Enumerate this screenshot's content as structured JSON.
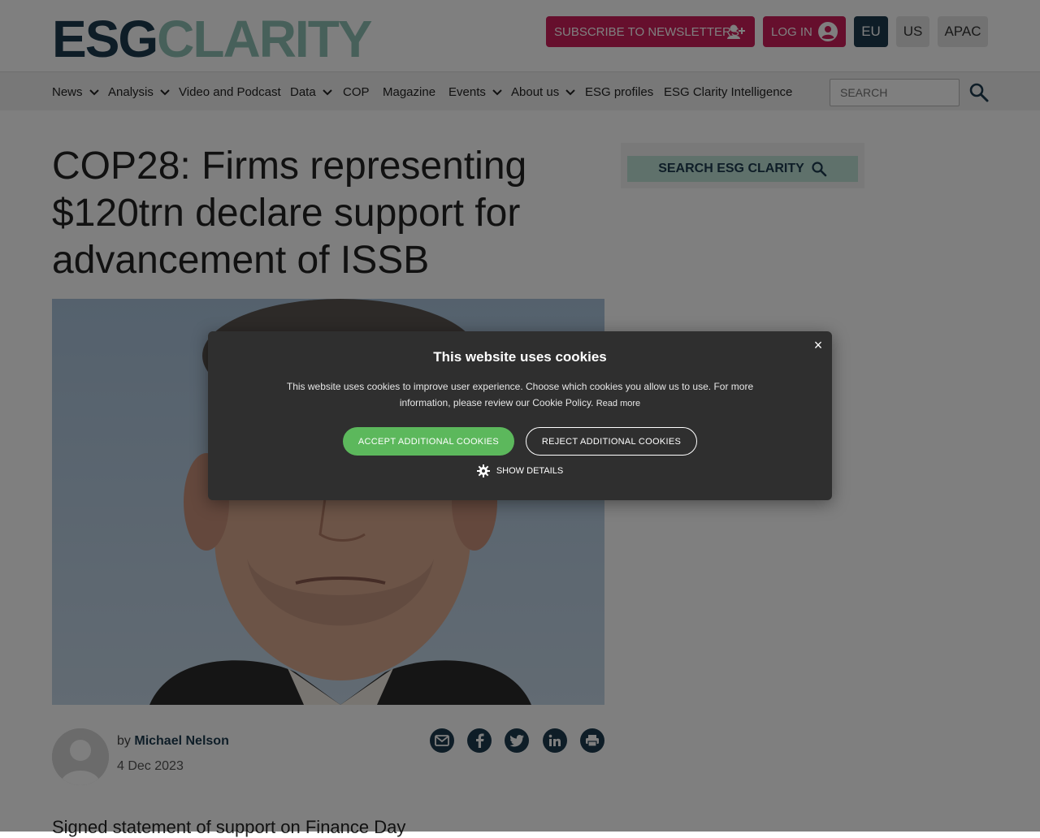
{
  "header": {
    "logo_part1": "ESG",
    "logo_part2": "CLARITY",
    "subscribe_label": "SUBSCRIBE TO NEWSLETTERS",
    "login_label": "LOG IN",
    "editions": [
      "EU",
      "US",
      "APAC"
    ],
    "active_edition": "EU"
  },
  "nav": {
    "items": [
      {
        "label": "News",
        "has_dropdown": true
      },
      {
        "label": "Analysis",
        "has_dropdown": true
      },
      {
        "label": "Video and Podcast",
        "has_dropdown": false
      },
      {
        "label": "Data",
        "has_dropdown": true
      },
      {
        "label": "COP",
        "has_dropdown": false
      },
      {
        "label": "Magazine",
        "has_dropdown": false
      },
      {
        "label": "Events",
        "has_dropdown": true
      },
      {
        "label": "About us",
        "has_dropdown": true
      },
      {
        "label": "ESG profiles",
        "has_dropdown": false
      },
      {
        "label": "ESG Clarity Intelligence",
        "has_dropdown": false
      }
    ],
    "search_placeholder": "SEARCH"
  },
  "article": {
    "headline": "COP28: Firms representing $120trn declare support for advancement of ISSB",
    "byline_prefix": "by",
    "author": "Michael Nelson",
    "date": "4 Dec 2023",
    "standfirst": "Signed statement of support on Finance Day"
  },
  "sidebar": {
    "search_label": "SEARCH ESG CLARITY"
  },
  "cookie_banner": {
    "title": "This website uses cookies",
    "text": "This website uses cookies to improve user experience. Choose which cookies you allow us to use. For more information, please review our Cookie Policy.",
    "read_more": "Read more",
    "accept_label": "ACCEPT ADDITIONAL COOKIES",
    "reject_label": "REJECT ADDITIONAL COOKIES",
    "show_details_label": "SHOW DETAILS",
    "close_symbol": "×"
  },
  "colors": {
    "brand_navy": "#1d3b4f",
    "brand_mint": "#8fc1b5",
    "brand_pink": "#cc1f5a",
    "accept_green": "#5cb85c",
    "modal_bg": "#2f2f2f"
  }
}
